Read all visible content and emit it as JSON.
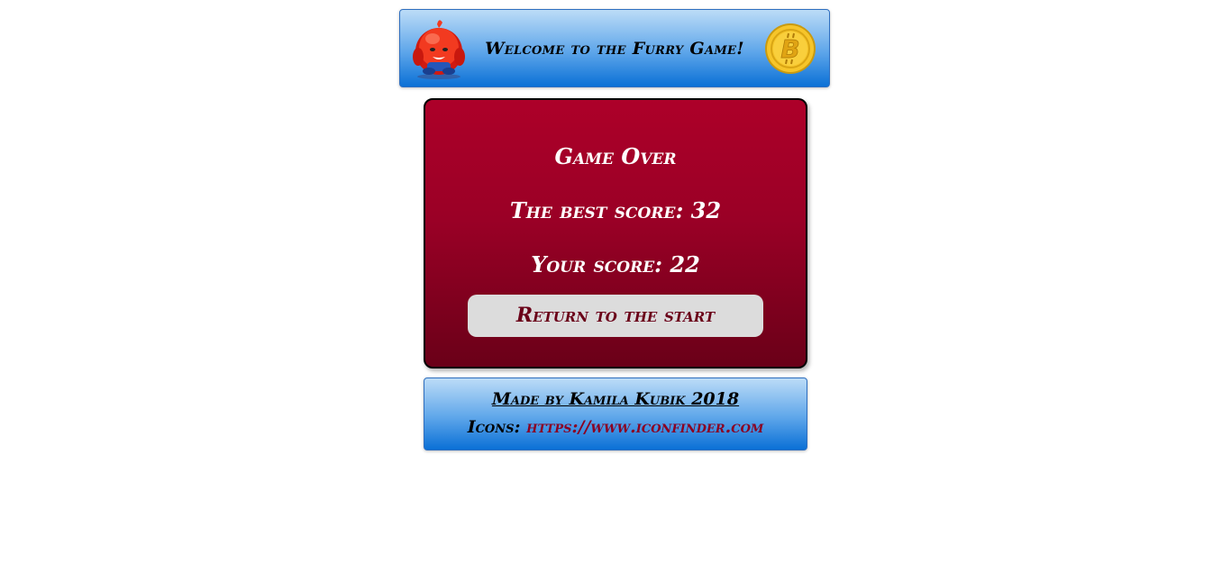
{
  "header": {
    "title": "Welcome to the Furry Game!",
    "left_icon": "furry-creature-icon",
    "right_icon": "bitcoin-coin-icon"
  },
  "panel": {
    "game_over": "Game Over",
    "best_score_label": "The best score:",
    "best_score": "32",
    "your_score_label": "Your score:",
    "your_score": "22",
    "return_button": "Return to the start"
  },
  "footer": {
    "author": "Made by Kamila Kubik 2018",
    "icons_label": "Icons:",
    "icons_link": "https://www.iconfinder.com"
  },
  "colors": {
    "panel_red": "#ad0029",
    "panel_dark_red": "#6a0018",
    "header_blue": "#0a70d6",
    "header_light_blue": "#bcdcf7",
    "button_gray": "#dcdcdc",
    "link_red": "#8a0022"
  }
}
